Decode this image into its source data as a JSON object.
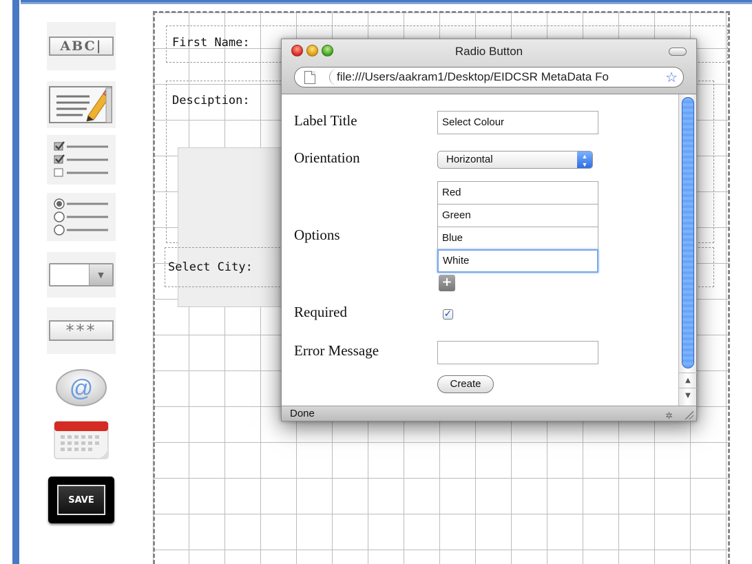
{
  "toolbox": {
    "abc_label": "ABC|",
    "password_label": "***",
    "save_label": "SAVE",
    "email_glyph": "@"
  },
  "form": {
    "first_name_label": "First Name:",
    "description_label": "Desciption:",
    "select_city_label": "Select City:"
  },
  "dialog": {
    "title": "Radio Button",
    "url": "file:///Users/aakram1/Desktop/EIDCSR MetaData Fo",
    "status": "Done",
    "fields": {
      "label_title": "Label Title",
      "label_title_value": "Select Colour",
      "orientation": "Orientation",
      "orientation_value": "Horizontal",
      "options": "Options",
      "option_values": [
        "Red",
        "Green",
        "Blue",
        "White"
      ],
      "required": "Required",
      "required_checked": true,
      "error_message": "Error Message",
      "error_message_value": ""
    },
    "create_label": "Create"
  },
  "colors": {
    "frame_blue": "#4a79c4",
    "scroll_blue": "#6aa4f8",
    "focus_blue": "#7aa7e6"
  }
}
